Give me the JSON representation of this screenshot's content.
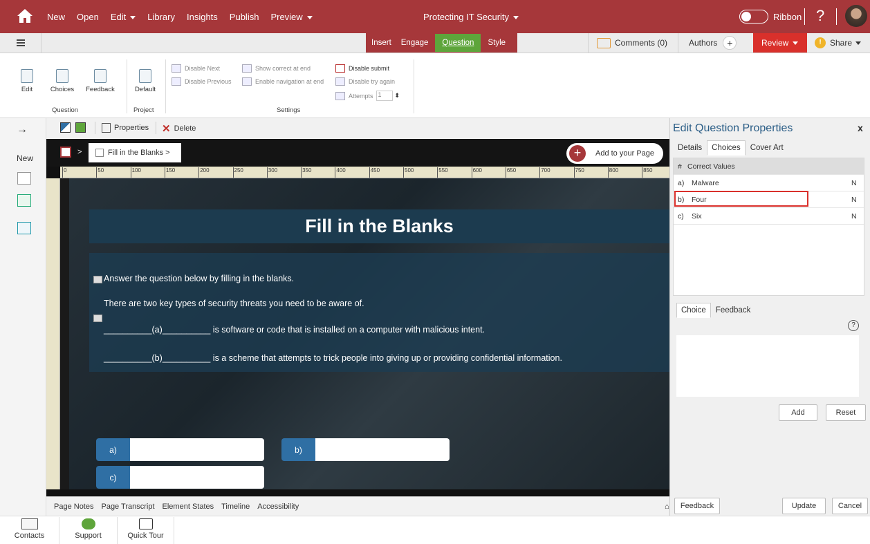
{
  "topbar": {
    "menu": [
      "New",
      "Open",
      "Edit",
      "Library",
      "Insights",
      "Publish",
      "Preview"
    ],
    "title": "Protecting IT Security",
    "ribbon_label": "Ribbon",
    "help": "?"
  },
  "tabs": {
    "insert": "Insert",
    "engage": "Engage",
    "question": "Question",
    "style": "Style",
    "comments": "Comments (0)",
    "authors": "Authors",
    "review": "Review",
    "share": "Share"
  },
  "ribbon": {
    "edit": "Edit",
    "choices": "Choices",
    "feedback": "Feedback",
    "default": "Default",
    "disable_next": "Disable Next",
    "disable_previous": "Disable Previous",
    "show_correct": "Show correct at end",
    "enable_nav": "Enable navigation at end",
    "disable_submit": "Disable submit",
    "disable_try": "Disable try again",
    "attempts": "Attempts",
    "attempts_value": "1",
    "group_question": "Question",
    "group_project": "Project",
    "group_settings": "Settings"
  },
  "toolbar": {
    "properties": "Properties",
    "delete": "Delete"
  },
  "left": {
    "new": "New"
  },
  "breadcrumb": {
    "sep": ">",
    "item": "Fill in the Blanks >",
    "add": "Add to your Page"
  },
  "ruler_ticks": [
    "0",
    "50",
    "100",
    "150",
    "200",
    "250",
    "300",
    "350",
    "400",
    "450",
    "500",
    "550",
    "600",
    "650",
    "700",
    "750",
    "800",
    "850"
  ],
  "slide": {
    "title": "Fill in the Blanks",
    "instruction": "Answer the question below by filling in the blanks.",
    "line1": "There are two key types of security threats you need to be aware of.",
    "line2": "__________(a)__________ is software or code that is installed on a computer with malicious intent.",
    "line3": "__________(b)__________ is a scheme that attempts to trick people into giving up or providing confidential information.",
    "answers": [
      "a)",
      "b)",
      "c)"
    ]
  },
  "bottom_tabs": [
    "Page Notes",
    "Page Transcript",
    "Element States",
    "Timeline",
    "Accessibility"
  ],
  "footer": [
    "Contacts",
    "Support",
    "Quick Tour"
  ],
  "panel": {
    "title": "Edit Question Properties",
    "close": "x",
    "tabs": [
      "Details",
      "Choices",
      "Cover Art"
    ],
    "col_num": "#",
    "col_values": "Correct Values",
    "rows": [
      {
        "id": "a)",
        "value": "Malware",
        "flag": "N"
      },
      {
        "id": "b)",
        "value": "Four",
        "flag": "N"
      },
      {
        "id": "c)",
        "value": "Six",
        "flag": "N"
      }
    ],
    "subtabs": [
      "Choice",
      "Feedback"
    ],
    "help": "?",
    "add": "Add",
    "reset": "Reset",
    "feedback_btn": "Feedback",
    "update": "Update",
    "cancel": "Cancel"
  },
  "colors": {
    "brand": "#a6373a",
    "question_tab": "#5ea53b",
    "review": "#d9302b",
    "answer_label": "#2f6fa4"
  }
}
